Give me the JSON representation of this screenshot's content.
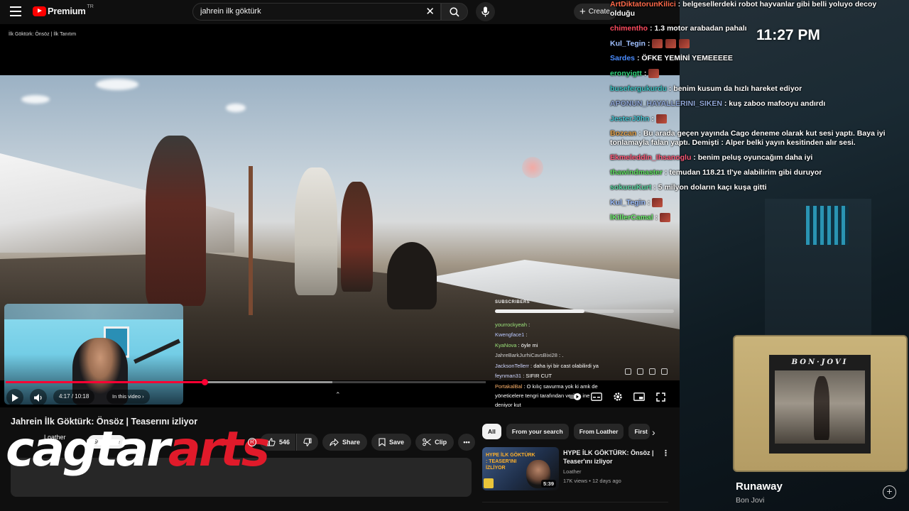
{
  "topbar": {
    "logo_text": "Premium",
    "logo_region": "TR",
    "search_value": "jahrein ilk göktürk",
    "create_label": "Create"
  },
  "player": {
    "overlay_title": "İlk Göktürk: Önsöz | İlk Tanıtım",
    "current_time": "4:17",
    "duration": "10:18",
    "in_this_video_label": "In this video",
    "played_fraction": 0.414,
    "buffered_fraction": 0.68,
    "subscribers_label": "SUBSCRIBERS",
    "subscribers_fraction": 0.5,
    "overlay_chat": [
      {
        "user": "yourrockyeah",
        "color": "#9be27a",
        "text": ""
      },
      {
        "user": "Kwengface1",
        "color": "#b9c8ff",
        "text": ""
      },
      {
        "user": "KyaNova",
        "color": "#9be27a",
        "text": "öyle mi"
      },
      {
        "user": "JahreBarkJurhiCavsBixi28",
        "color": "#cfcfcf",
        "text": "."
      },
      {
        "user": "JacksonTellerr",
        "color": "#cfd6ff",
        "text": "daha iyi bir cast olabilirdi ya"
      },
      {
        "user": "feynman31",
        "color": "#cfd6ff",
        "text": "SIFIR CUT"
      },
      {
        "user": "PortakalBal",
        "color": "#ffb36b",
        "text": "O kılıç savurma yok ki amk de yöneticelere tengri tarafından verilen ine deniyor kut"
      }
    ]
  },
  "video": {
    "title": "Jahrein İlk Göktürk: Önsöz | Teaserını izliyor",
    "channel": "Loather",
    "subscribe_label": "Subscribe",
    "likes": "546",
    "share_label": "Share",
    "save_label": "Save",
    "clip_label": "Clip"
  },
  "watermark": {
    "part1": "cagtar",
    "part2": "arts",
    "reg": "R"
  },
  "recommendations": {
    "chips": [
      "All",
      "From your search",
      "From Loather",
      "First"
    ],
    "items": [
      {
        "thumb_text": "HYPE İLK GÖKTÜRK : TEASER'INI İZLİYOR",
        "duration": "5:39",
        "title": "HYPE İLK GÖKTÜRK: Önsöz | Teaser'ını izliyor",
        "channel": "Loather",
        "meta": "17K views • 12 days ago"
      }
    ]
  },
  "stream": {
    "clock": "11:27 PM",
    "chat": [
      {
        "user": "ArtDiktatorunKilici",
        "color": "#ff6a4a",
        "text": "belgesellerdeki robot hayvanlar gibi belli yoluyo decoy olduğu",
        "wrap": true
      },
      {
        "user": "chimentho",
        "color": "#ff4a5e",
        "text": "1.3 motor arabadan pahalı"
      },
      {
        "user": "Kul_Tegin",
        "color": "#9fc0ff",
        "text": "",
        "emotes": 3
      },
      {
        "user": "Sardes",
        "color": "#4a8cff",
        "text": "ÖFKE YEMİNİ YEMEEEEE"
      },
      {
        "user": "eronyigtt",
        "color": "#2fd07a",
        "text": "",
        "emotes": 1
      },
      {
        "user": "busefergukurdu",
        "color": "#3ec5c5",
        "text": "benim kusum da hızlı hareket ediyor"
      },
      {
        "user": "APONUN_HAYALLERINI_SIKEN",
        "color": "#8fa6d6",
        "text": "kuş zaboo mafooyu andırdı"
      },
      {
        "user": "JesterJ0hn",
        "color": "#4ac8d6",
        "text": "",
        "emotes": 1
      },
      {
        "user": "Bozcan",
        "color": "#e0a04a",
        "text": "Bu arada geçen yayında Cago deneme olarak kut sesi yaptı. Baya iyi tonlamayla falan yaptı. Demişti : Alper belki yayın kesitinden alır sesi.",
        "wrap": true
      },
      {
        "user": "Ekmeleddin_Ihsanoglu",
        "color": "#ff5a7a",
        "text": "benim peluş oyuncağım daha iyi"
      },
      {
        "user": "thawindmaster",
        "color": "#5ee05e",
        "text": "temudan 118.21 tl'ye alabilirim gibi duruyor"
      },
      {
        "user": "sokucuKurt",
        "color": "#5ad6a0",
        "text": "5 milyon doların kaçı kuşa gitti"
      },
      {
        "user": "Kul_Tegin",
        "color": "#9fc0ff",
        "text": "",
        "emotes": 1
      },
      {
        "user": "lKillerCamal",
        "color": "#6ef06e",
        "text": "",
        "emotes": 1
      }
    ],
    "now_playing": {
      "album_art_text": "BON·JOVI",
      "title": "Runaway",
      "artist": "Bon Jovi",
      "add_label": "+"
    }
  }
}
